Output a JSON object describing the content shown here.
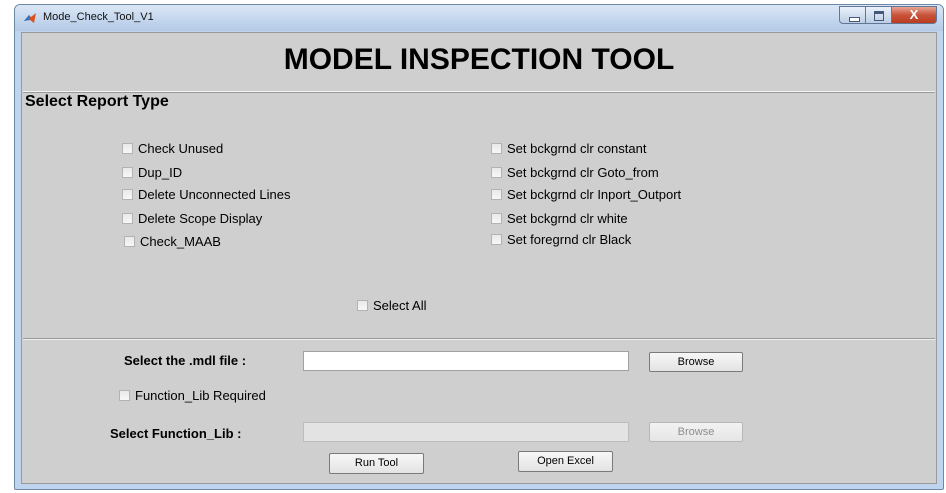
{
  "window": {
    "title": "Mode_Check_Tool_V1",
    "close_symbol": "X"
  },
  "app": {
    "main_title": "MODEL INSPECTION TOOL"
  },
  "report_panel": {
    "title": "Select Report Type",
    "left_options": [
      "Check Unused",
      "Dup_ID",
      "Delete Unconnected Lines",
      "Delete Scope Display",
      "Check_MAAB"
    ],
    "right_options": [
      "Set bckgrnd clr constant",
      "Set bckgrnd clr Goto_from",
      "Set bckgrnd clr Inport_Outport",
      "Set bckgrnd clr white",
      "Set foregrnd clr Black"
    ],
    "select_all": "Select All"
  },
  "file_panel": {
    "mdl_label": "Select the .mdl file :",
    "mdl_value": "",
    "browse_label": "Browse",
    "function_lib_checkbox": "Function_Lib Required",
    "function_lib_label": "Select  Function_Lib :",
    "function_lib_value": "",
    "browse2_label": "Browse",
    "run_label": "Run Tool",
    "excel_label": "Open Excel"
  },
  "icons": {
    "app_icon": "matlab-icon",
    "minimize": "minimize-icon",
    "maximize": "maximize-icon",
    "close": "close-icon"
  },
  "colors": {
    "titlebar": "#c5d7ee",
    "background": "#cfcfcf",
    "close_button": "#c9533a"
  }
}
